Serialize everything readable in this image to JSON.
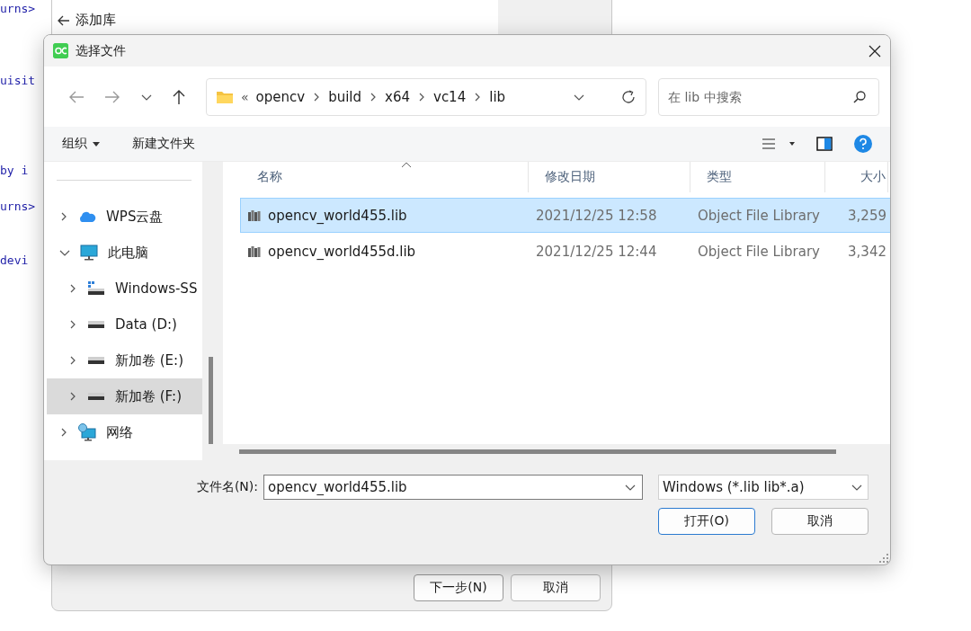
{
  "code_editor": {
    "lines": [
      "urns>",
      "uisit",
      "by i",
      "urns>",
      "devi"
    ]
  },
  "wizard": {
    "title": "添加库",
    "buttons": [
      {
        "label": "下一步(N)",
        "kind": "primary"
      },
      {
        "label": "取消",
        "kind": "normal"
      }
    ]
  },
  "dialog": {
    "title": "选择文件",
    "address": {
      "overflow": "«",
      "crumbs": [
        "opencv",
        "build",
        "x64",
        "vc14",
        "lib"
      ]
    },
    "search": {
      "placeholder": "在 lib 中搜索"
    },
    "toolbar": {
      "organize": "组织",
      "new_folder": "新建文件夹"
    },
    "sidebar": {
      "items": [
        {
          "label": "WPS云盘",
          "kind": "cloud",
          "expanded": false,
          "selected": false
        },
        {
          "label": "此电脑",
          "kind": "computer",
          "expanded": true,
          "selected": false,
          "children": [
            {
              "label": "Windows-SS",
              "kind": "system-drive",
              "expanded": false,
              "selected": false
            },
            {
              "label": "Data (D:)",
              "kind": "drive",
              "expanded": false,
              "selected": false
            },
            {
              "label": "新加卷 (E:)",
              "kind": "drive",
              "expanded": false,
              "selected": false
            },
            {
              "label": "新加卷 (F:)",
              "kind": "drive",
              "expanded": false,
              "selected": true
            }
          ]
        },
        {
          "label": "网络",
          "kind": "network",
          "expanded": false,
          "selected": false
        }
      ]
    },
    "table": {
      "columns": [
        "名称",
        "修改日期",
        "类型",
        "大小"
      ],
      "rows": [
        {
          "name": "opencv_world455.lib",
          "modified": "2021/12/25 12:58",
          "type": "Object File Library",
          "size": "3,259",
          "selected": true
        },
        {
          "name": "opencv_world455d.lib",
          "modified": "2021/12/25 12:44",
          "type": "Object File Library",
          "size": "3,342",
          "selected": false
        }
      ]
    },
    "file_name": {
      "label": "文件名(N):",
      "value": "opencv_world455.lib"
    },
    "file_type": {
      "value": "Windows (*.lib lib*.a)"
    },
    "buttons": [
      {
        "label": "打开(O)",
        "kind": "primary"
      },
      {
        "label": "取消",
        "kind": "normal"
      }
    ]
  }
}
